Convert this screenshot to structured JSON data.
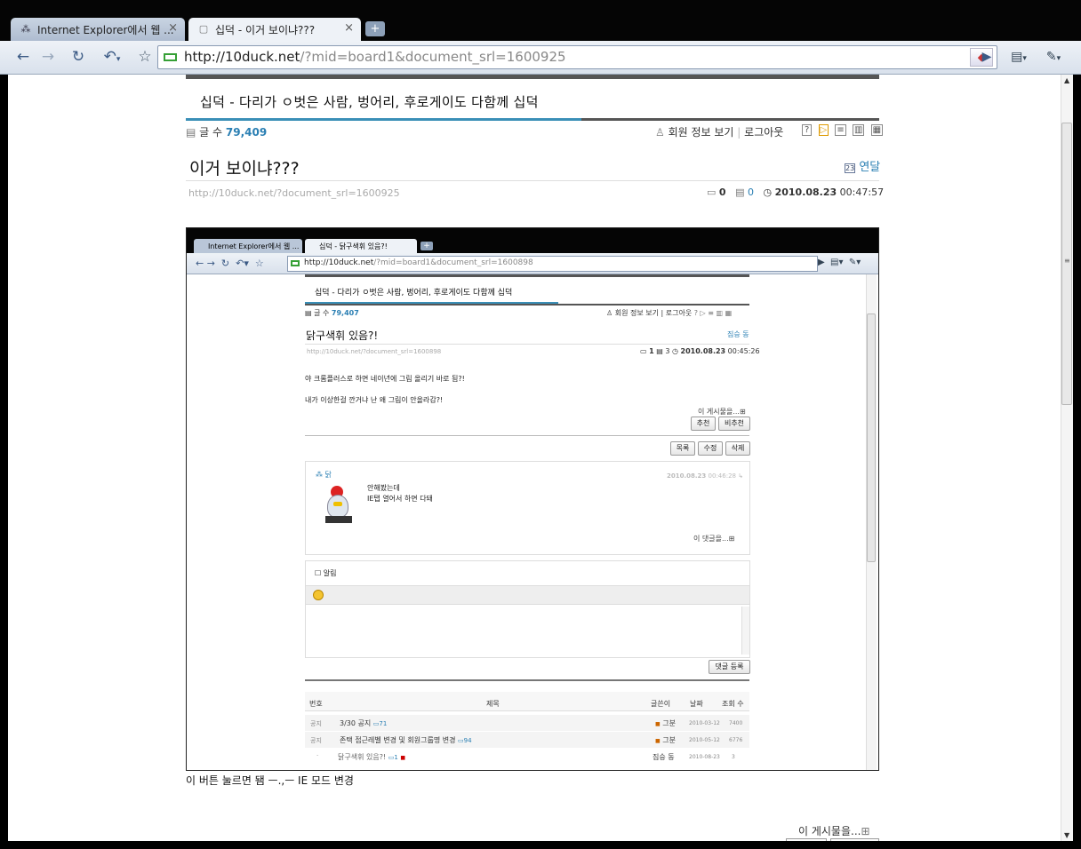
{
  "browser": {
    "tabs": [
      {
        "title": "Internet Explorer에서 웹 ...",
        "active": false
      },
      {
        "title": "십덕 - 이거 보이냐???",
        "active": true
      }
    ],
    "url_host": "http://10duck.net",
    "url_path": "/?mid=board1&document_srl=1600925"
  },
  "site": {
    "title": "십덕 - 다리가 ㅇ벗은 사람, 벙어리, 후로게이도 다함께 십덕",
    "post_count_label": "글 수",
    "post_count": "79,409",
    "member_info": "회원 정보 보기",
    "logout": "로그아웃"
  },
  "post": {
    "title": "이거 보이냐???",
    "author": "연달",
    "permalink": "http://10duck.net/?document_srl=1600925",
    "comments": "0",
    "trackbacks": "0",
    "date": "2010.08.23",
    "time": "00:47:57",
    "caption": "이 버튼 눌르면 됌 ㅡ.,ㅡ IE 모드 변경",
    "this_post": "이 게시물을..."
  },
  "shot": {
    "tabs": [
      "Internet Explorer에서 웹 ...",
      "십덕 - 닭구색휘 있음?!"
    ],
    "url_host": "http://10duck.net",
    "url_path": "/?mid=board1&document_srl=1600898",
    "site_title": "십덕 - 다리가 ㅇ벗은 사람, 벙어리, 후로게이도 다함께 십덕",
    "post_count_label": "글 수",
    "post_count": "79,407",
    "member_info": "회원 정보 보기",
    "logout": "로그아웃",
    "post_title": "닭구색휘 있음?!",
    "post_author": "짐승 동",
    "permalink": "http://10duck.net/?document_srl=1600898",
    "comments": "1",
    "trackbacks": "3",
    "date": "2010.08.23",
    "time": "00:45:26",
    "body1": "야 크롬플러스로 하면 네이년에 그림 올리기 바로 됨?!",
    "body2": "내가 이상한걸 깐거냐 난 왜 그림이 안올라감?!",
    "this_post": "이 게시물을...",
    "recommend": "추천",
    "not_recommend": "비추천",
    "list": "목록",
    "edit": "수정",
    "delete": "삭제",
    "commenter": "닭",
    "comment_date": "2010.08.23",
    "comment_time": "00:46:28",
    "comment_line1": "안해봤는데",
    "comment_line2": "IE탭 열어서 하면 다돼",
    "this_comment": "이 댓글을...",
    "notify": "알림",
    "submit_comment": "댓글 등록",
    "table_headers": [
      "번호",
      "제목",
      "글쓴이",
      "날짜",
      "조회 수"
    ],
    "rows": [
      {
        "no": "공지",
        "title": "3/30 공지",
        "comments": "71",
        "author": "그분",
        "date": "2010-03-12",
        "views": "7400"
      },
      {
        "no": "공지",
        "title": "존택 접근레벨 변경 및 회원그룹명 변경",
        "comments": "94",
        "author": "그분",
        "date": "2010-05-12",
        "views": "6776"
      },
      {
        "no": "·",
        "title": "닭구색휘 있음?!",
        "comments": "1",
        "author": "짐승 동",
        "date": "2010-08-23",
        "views": "3"
      }
    ]
  }
}
